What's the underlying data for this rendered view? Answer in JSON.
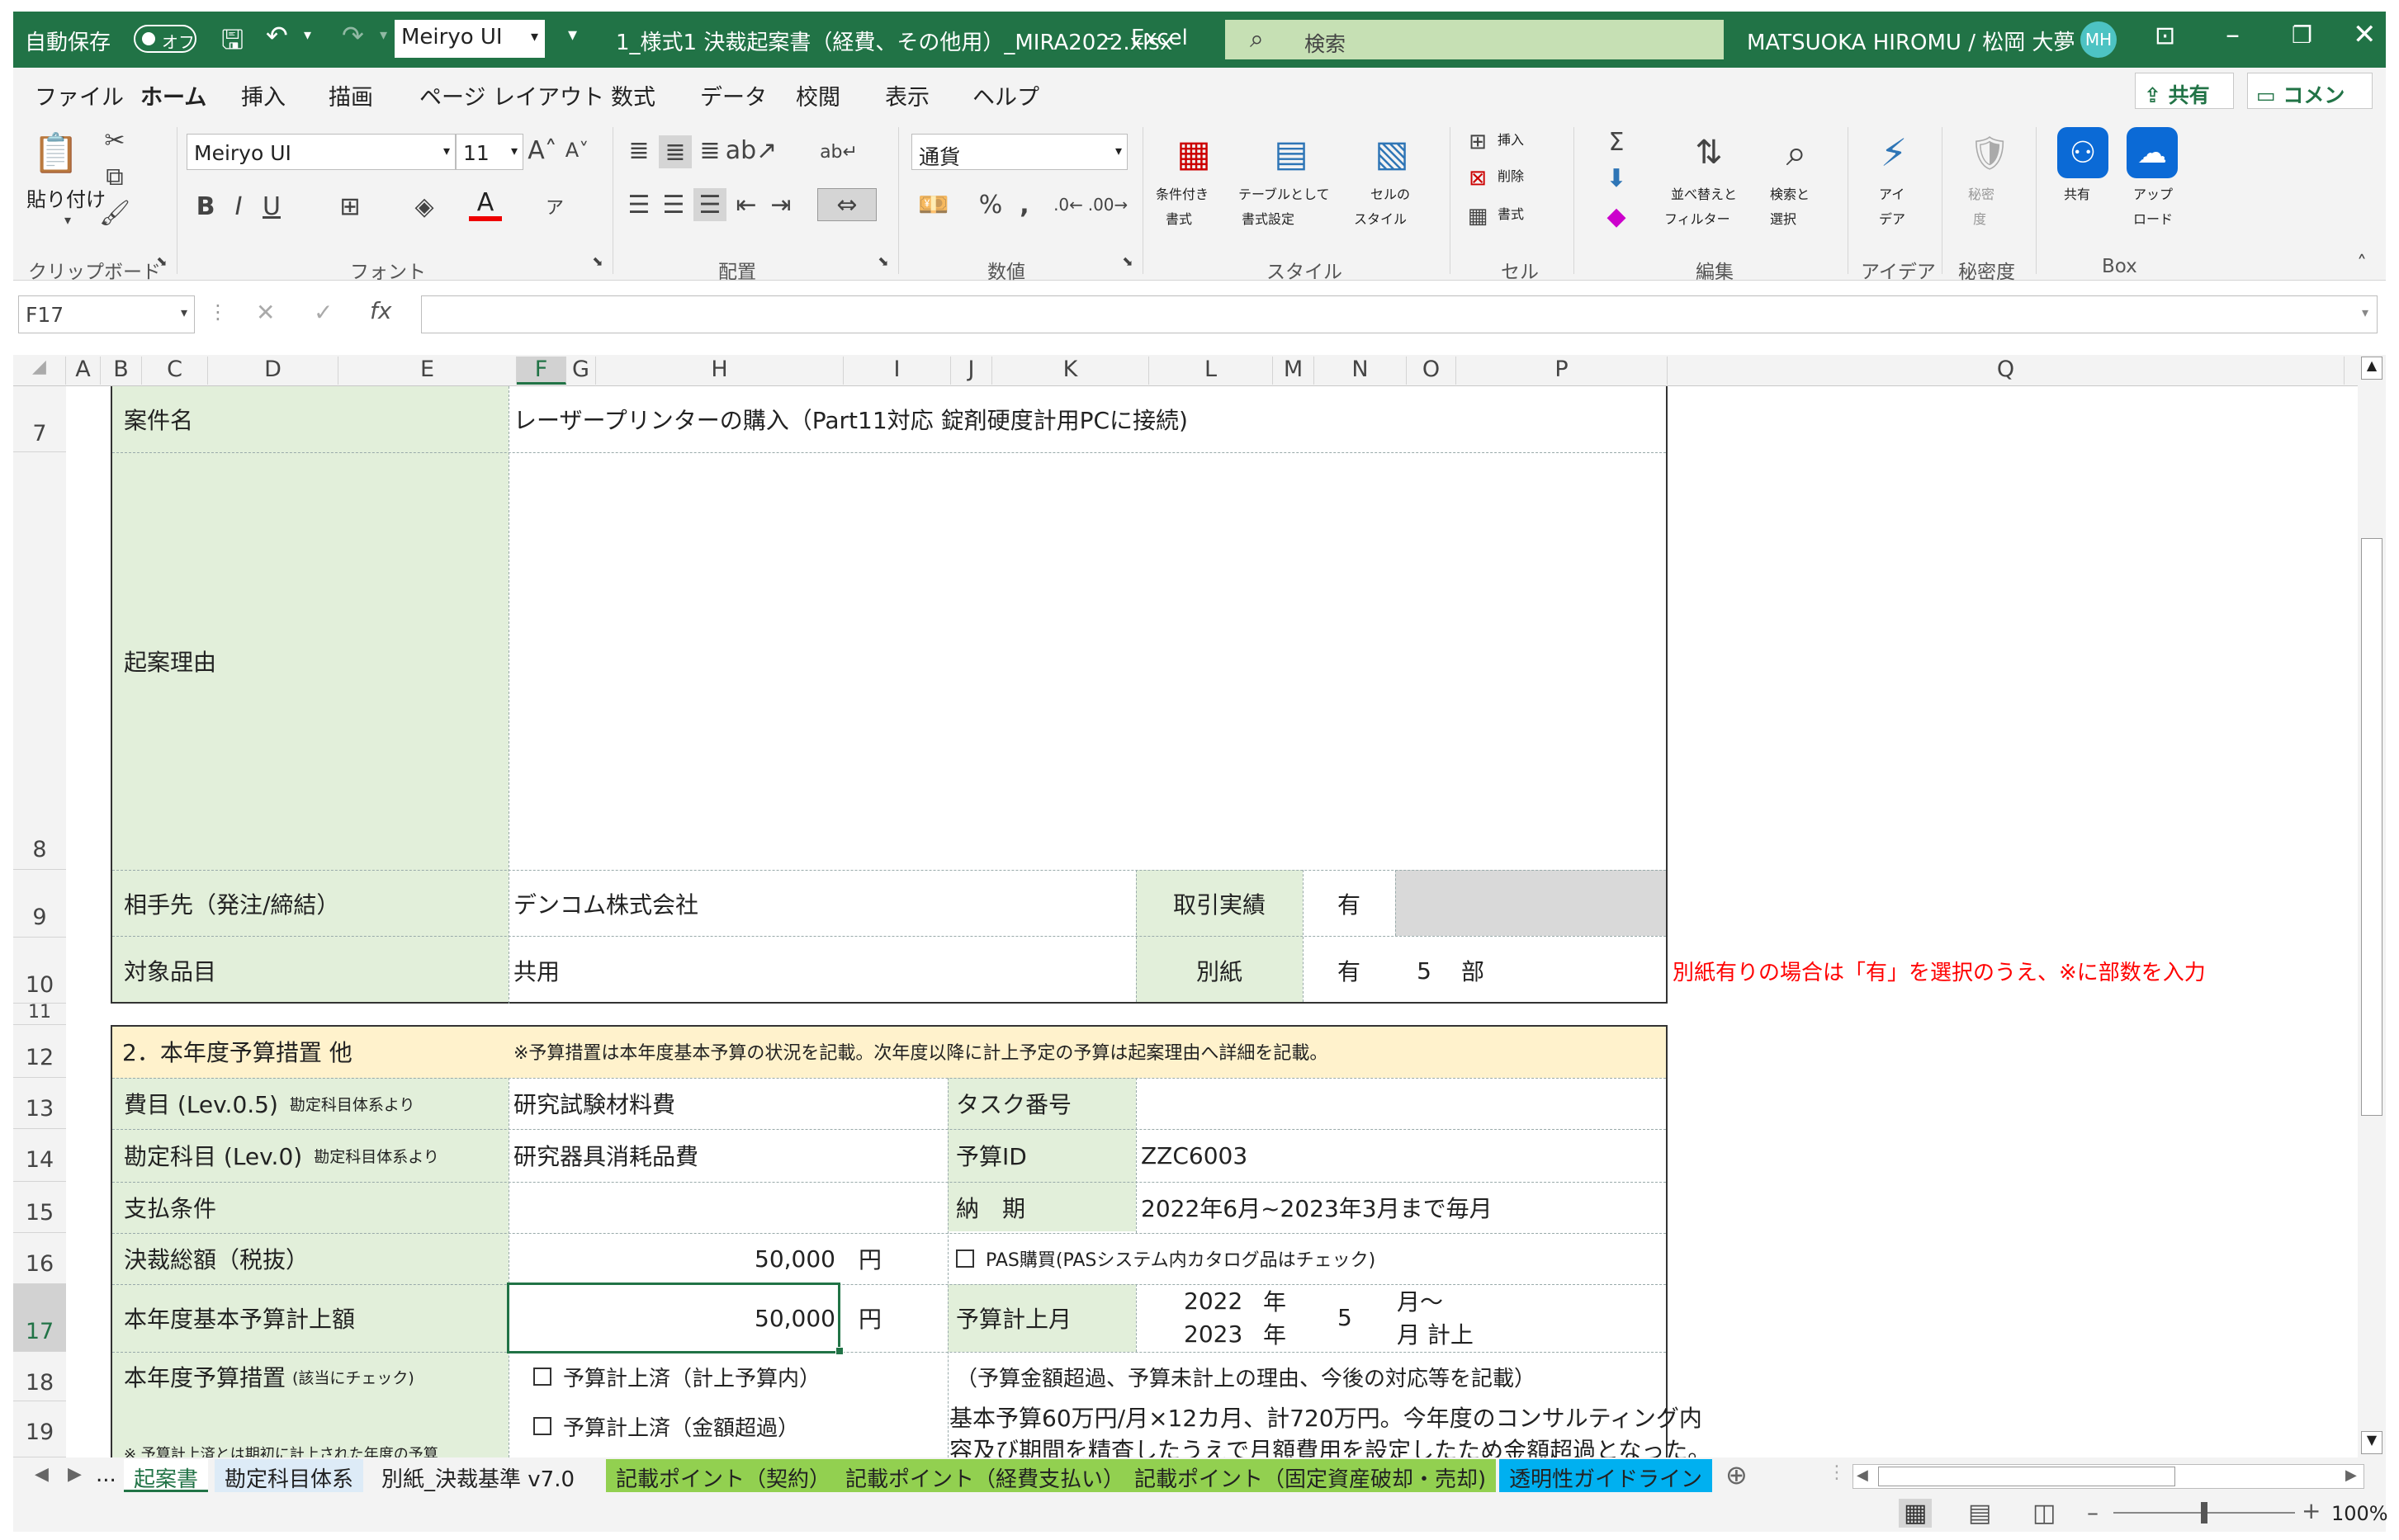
{
  "titlebar": {
    "autosave_label": "自動保存",
    "autosave_state": "オフ",
    "font_box": "Meiryo UI",
    "filename": "1_様式1 決裁起案書（経費、その他用）_MIRA2022.xlsx",
    "separator": "-",
    "app_name": "Excel",
    "search_placeholder": "検索",
    "user_name": "MATSUOKA HIROMU / 松岡 大夢",
    "user_initials": "MH"
  },
  "ribbon_tabs": [
    "ファイル",
    "ホーム",
    "挿入",
    "描画",
    "ページ レイアウト",
    "数式",
    "データ",
    "校閲",
    "表示",
    "ヘルプ"
  ],
  "ribbon_actions": {
    "share": "共有",
    "comment": "コメント"
  },
  "ribbon": {
    "paste": "貼り付け",
    "font_name": "Meiryo UI",
    "font_size": "11",
    "number_format": "通貨",
    "conditional": [
      "条件付き",
      "書式"
    ],
    "table": [
      "テーブルとして",
      "書式設定"
    ],
    "cellstyle": [
      "セルの",
      "スタイル"
    ],
    "insert": "挿入",
    "delete": "削除",
    "format": "書式",
    "sort": [
      "並べ替えと",
      "フィルター"
    ],
    "find": [
      "検索と",
      "選択"
    ],
    "ideas": [
      "アイ",
      "デア"
    ],
    "sensitivity": [
      "秘密",
      "度"
    ],
    "share": "共有",
    "upload": [
      "アップ",
      "ロード"
    ],
    "groups": [
      "クリップボード",
      "フォント",
      "配置",
      "数値",
      "スタイル",
      "セル",
      "編集",
      "アイデア",
      "秘密度",
      "Box"
    ]
  },
  "formula_bar": {
    "name_box": "F17",
    "fx": "fx",
    "content": ""
  },
  "columns": [
    "A",
    "B",
    "C",
    "D",
    "E",
    "F",
    "G",
    "H",
    "I",
    "J",
    "K",
    "L",
    "M",
    "N",
    "O",
    "P",
    "Q"
  ],
  "rows": [
    "7",
    "8",
    "9",
    "10",
    "11",
    "12",
    "13",
    "14",
    "15",
    "16",
    "17",
    "18",
    "19"
  ],
  "sheet": {
    "r7_label": "案件名",
    "r7_value": "レーザープリンターの購入（Part11対応 錠剤硬度計用PCに接続)",
    "r8_label": "起案理由",
    "r9_label": "相手先（発注/締結）",
    "r9_value": "デンコム株式会社",
    "r9_k": "取引実績",
    "r9_n": "有",
    "r10_label": "対象品目",
    "r10_value": "共用",
    "r10_k": "別紙",
    "r10_n": "有",
    "r10_o": "5",
    "r10_p": "部",
    "r10_note": "別紙有りの場合は「有」を選択のうえ、※に部数を入力",
    "r12_title": "2．本年度予算措置 他",
    "r12_note": "※予算措置は本年度基本予算の状況を記載。次年度以降に計上予定の予算は起案理由へ詳細を記載。",
    "r13_label": "費目 (Lev.0.5)",
    "r13_small": "勘定科目体系より",
    "r13_value": "研究試験材料費",
    "r13_k": "タスク番号",
    "r14_label": "勘定科目 (Lev.0)",
    "r14_small": "勘定科目体系より",
    "r14_value": "研究器具消耗品費",
    "r14_k": "予算ID",
    "r14_v": "ZZC6003",
    "r15_label": "支払条件",
    "r15_k": "納　期",
    "r15_v": "2022年6月~2023年3月まで毎月",
    "r16_label": "決裁総額（税抜）",
    "r16_value": "50,000",
    "r16_unit": "円",
    "r16_check": "PAS購買(PASシステム内カタログ品はチェック)",
    "r17_label": "本年度基本予算計上額",
    "r17_value": "50,000",
    "r17_unit": "円",
    "r17_k": "予算計上月",
    "r17_y1": "2022",
    "r17_nen1": "年",
    "r17_m": "5",
    "r17_tsuki1": "月～",
    "r17_y2": "2023",
    "r17_nen2": "年",
    "r17_tsuki2": "月 計上",
    "r18_label": "本年度予算措置",
    "r18_small": "(該当にチェック)",
    "r18_opt1": "予算計上済（計上予算内）",
    "r18_note": "（予算金額超過、予算未計上の理由、今後の対応等を記載）",
    "r19_opt2": "予算計上済（金額超過）",
    "r19_text1": "基本予算60万円/月×12カ月、計720万円。今年度のコンサルティング内",
    "r19_text2": "容及び期間を精査したうえで月額費用を設定したため金額超過となった。",
    "r19_small": "※ 予算計上済とは期初に計上された年度の予算"
  },
  "sheet_tabs": [
    {
      "label": "起案書",
      "color": "#ffffff",
      "text": "#217346"
    },
    {
      "label": "勘定科目体系",
      "color": "#ddebf7",
      "text": "#222"
    },
    {
      "label": "別紙_決裁基準  v7.0",
      "color": "#f3f3f3",
      "text": "#222"
    },
    {
      "label": "記載ポイント（契約）",
      "color": "#92d050",
      "text": "#222"
    },
    {
      "label": "記載ポイント（経費支払い）",
      "color": "#92d050",
      "text": "#222"
    },
    {
      "label": "記載ポイント（固定資産破却・売却)",
      "color": "#92d050",
      "text": "#222"
    },
    {
      "label": "透明性ガイドライン",
      "color": "#00b0f0",
      "text": "#222"
    }
  ],
  "sheet_nav_more": "...",
  "zoom": "100%",
  "colors": {
    "excel_green": "#217346",
    "label_fill": "#e2efda",
    "header_fill": "#fff2cc",
    "note_red": "#ff0000"
  }
}
